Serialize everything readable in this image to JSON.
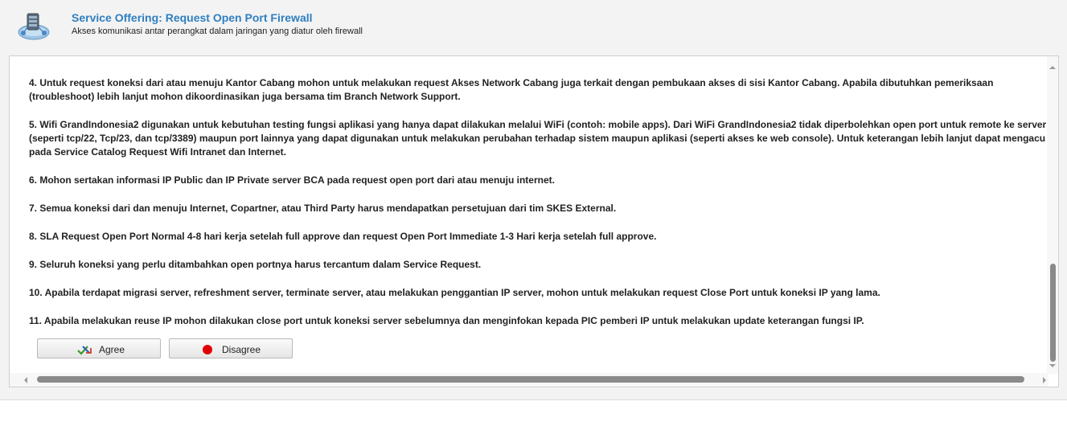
{
  "header": {
    "title": "Service Offering: Request Open Port Firewall",
    "subtitle": "Akses komunikasi antar perangkat dalam jaringan yang diatur oleh firewall",
    "icon": "network-service-icon"
  },
  "terms": [
    "4.    Untuk request koneksi dari atau menuju Kantor Cabang mohon untuk melakukan request Akses Network Cabang juga terkait dengan pembukaan akses di sisi Kantor Cabang. Apabila dibutuhkan pemeriksaan (troubleshoot) lebih lanjut mohon dikoordinasikan juga bersama tim Branch Network Support.",
    "5.    Wifi GrandIndonesia2 digunakan untuk kebutuhan testing fungsi aplikasi yang hanya dapat dilakukan melalui WiFi (contoh: mobile apps). Dari WiFi GrandIndonesia2 tidak diperbolehkan open port untuk remote ke server (seperti tcp/22, Tcp/23, dan tcp/3389) maupun port lainnya yang dapat digunakan untuk melakukan perubahan terhadap sistem maupun aplikasi (seperti akses ke web console). Untuk keterangan lebih lanjut dapat mengacu pada Service Catalog Request Wifi Intranet dan Internet.",
    "6.    Mohon sertakan informasi IP Public dan IP Private server BCA pada request open port dari atau menuju internet.",
    "7.    Semua koneksi dari dan menuju Internet, Copartner, atau Third Party harus mendapatkan persetujuan dari tim SKES External.",
    "8.    SLA Request Open Port Normal 4-8 hari kerja setelah full approve dan request Open Port Immediate 1-3 Hari kerja setelah full approve.",
    "9.    Seluruh koneksi yang perlu ditambahkan open portnya harus tercantum dalam Service Request.",
    "10. Apabila terdapat migrasi server, refreshment server, terminate server, atau melakukan penggantian IP server, mohon untuk melakukan request Close Port untuk koneksi IP yang lama.",
    "11. Apabila melakukan reuse IP mohon dilakukan close port untuk koneksi server sebelumnya dan menginfokan kepada PIC pemberi IP untuk melakukan update keterangan fungsi IP."
  ],
  "buttons": {
    "agree_label": "Agree",
    "agree_icon": "checklist-approve-icon",
    "disagree_label": "Disagree",
    "disagree_icon": "red-dot-icon"
  },
  "colors": {
    "title": "#2f7fc1",
    "disagree_dot": "#e10000"
  }
}
